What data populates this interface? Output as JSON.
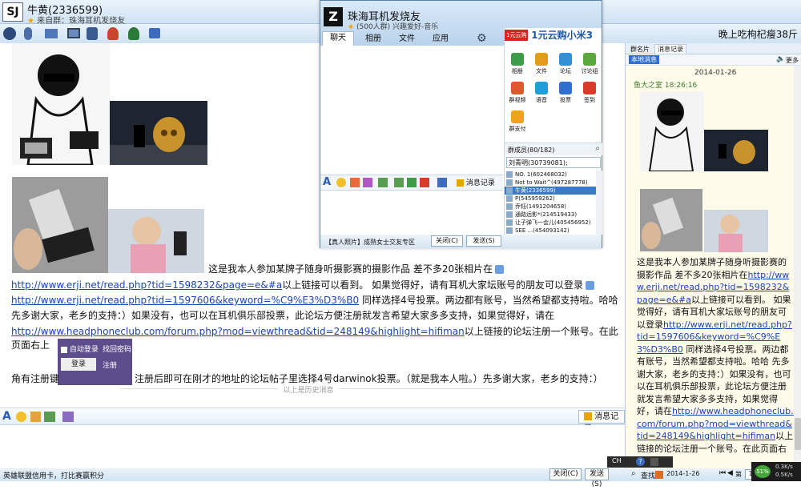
{
  "main_chat": {
    "contact_name": "牛黄(2336599)",
    "contact_signature": "来自群：珠海耳机发烧友",
    "message_text_1": "这是我本人参加某牌子随身听摄影赛的摄影作品 差不多20张相片在",
    "link_1": "http://www.erji.net/read.php?tid=1598232&page=e&#a",
    "message_text_2": "以上链接可以看到。 如果觉得好，请有耳机大家坛账号的朋友可以登录",
    "link_2": "http://www.erji.net/read.php?tid=1597606&keyword=%C9%E3%D3%B0",
    "message_text_3": " 同样选择4号投票。两边都有账号，当然希望都支持啦。哈哈 先多谢大家，老乡的支持：）如果没有，也可以在耳机俱乐部投票，此论坛方便注册就发言希望大家多多支持，如果觉得好，请在",
    "link_3": "http://www.headphoneclub.com/forum.php?mod=viewthread&tid=248149&highlight=hifiman",
    "message_text_4": "以上链接的论坛注册一个账号。在此页面右上",
    "message_text_5": "角有注册键",
    "message_text_6": "注册后即可在刚才的地址的论坛帖子里选择4号darwinok投票。（就是我本人啦。）先多谢大家，老乡的支持：）",
    "history_divider": "以上是历史消息",
    "login_auto": "自动登录",
    "login_button": "登录",
    "login_recover": "找回密码",
    "login_register": "注册",
    "record_button": "消息记录",
    "status_text": "英雄联盟信用卡，打比赛赢积分",
    "close_button": "关闭(C)",
    "send_button": "发送(S)"
  },
  "top_right_banner": "晚上吃枸杞瘦38斤",
  "group_window": {
    "title": "珠海耳机发烧友",
    "subtitle": "(500人群) 兴趣爱好-音乐",
    "tabs": [
      "聊天",
      "相册",
      "文件",
      "应用"
    ],
    "ad_brand": "1元云购",
    "ad_text": "1元云购小米3",
    "apps": [
      {
        "label": "相册",
        "color": "#3d9c48"
      },
      {
        "label": "文件",
        "color": "#e39b1c"
      },
      {
        "label": "论坛",
        "color": "#2f8fd8"
      },
      {
        "label": "讨论组",
        "color": "#5aa73e"
      },
      {
        "label": "群视频",
        "color": "#e0572b"
      },
      {
        "label": "语音",
        "color": "#1f9fd6"
      },
      {
        "label": "投票",
        "color": "#2f6fd0"
      },
      {
        "label": "签到",
        "color": "#d93b2b"
      },
      {
        "label": "群支付",
        "color": "#f1a21d"
      }
    ],
    "member_count": "群成员(80/182)",
    "search_value": "刘青明(30739081);",
    "members": [
      "NO. 1(602468032)",
      "Not to Wait^(497287778)",
      "牛黄(2336599)",
      "P(545959262)",
      "乔钰(1491204658)",
      "通路远影*(214519433)",
      "让子弹飞一会儿(405456952)",
      "SEE   ...(454093142)"
    ],
    "selected_member_index": 2,
    "footer_text": "【真人照片】成熟女士交友专区",
    "close_button": "关闭(C)",
    "send_button": "发送(S)",
    "record_button": "消息记录"
  },
  "right_panel": {
    "tabs": [
      "群名片",
      "消息记录"
    ],
    "sub_tab": "本地消息",
    "more": "更多",
    "date": "2014-01-26",
    "sender": "鱼大之室 18:26:16",
    "message": "这是我本人参加某牌子随身听摄影赛的摄影作品 差不多20张相片在",
    "link_1": "http://www.erji.net/read.php?tid=1598232&page=e&#a",
    "text_2": "以上链接可以看到。 如果觉得好，请有耳机大家坛账号的朋友可以登录",
    "link_2": "http://www.erji.net/read.php?tid=1597606&keyword=%C9%E3%D3%B0",
    "text_3": " 同样选择4号投票。两边都有账号，当然希望都支持啦。哈哈 先多谢大家，老乡的支持：）如果没有，也可以在耳机俱乐部投票，此论坛方便注册就发言希望大家多多支持，如果觉得好，请在",
    "link_3": "http://www.headphoneclub.com/forum.php?mod=viewthread&tid=248149&highlight=hifiman",
    "text_4": "以上链接的论坛注册一个账号。在此页面右上",
    "search_label": "查找",
    "search_date": "2014-1-26",
    "page_label": "第",
    "page_value": "1",
    "page_total": "页"
  },
  "tray": {
    "speed_up": "0.3K/s",
    "speed_down": "0.5K/s",
    "percent": "51%",
    "ch_label": "CH"
  }
}
